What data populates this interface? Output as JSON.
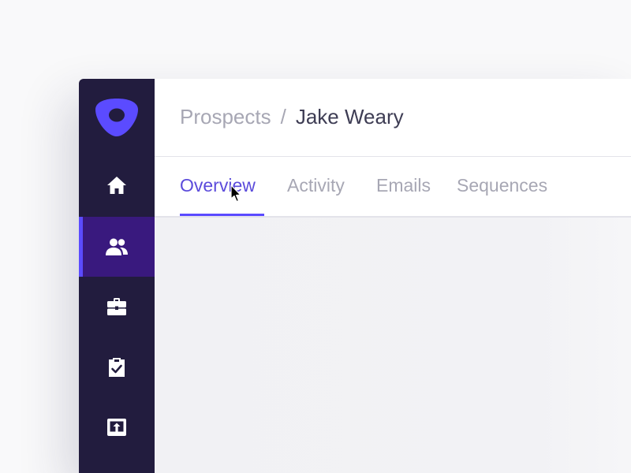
{
  "breadcrumb": {
    "parent": "Prospects",
    "separator": "/",
    "current": "Jake Weary"
  },
  "tabs": [
    {
      "label": "Overview",
      "active": true
    },
    {
      "label": "Activity",
      "active": false
    },
    {
      "label": "Emails",
      "active": false
    },
    {
      "label": "Sequences",
      "active": false
    }
  ],
  "sidebar": {
    "logo": "outreach-logo-icon",
    "items": [
      {
        "icon": "home-icon",
        "active": false
      },
      {
        "icon": "people-icon",
        "active": true
      },
      {
        "icon": "briefcase-icon",
        "active": false
      },
      {
        "icon": "clipboard-check-icon",
        "active": false
      },
      {
        "icon": "upload-icon",
        "active": false
      }
    ]
  },
  "colors": {
    "sidebar_bg": "#221c3e",
    "sidebar_active_bg": "#39197e",
    "accent": "#5b4bff",
    "tab_active_text": "#5b4bdb",
    "muted_text": "#a7a7b4",
    "title_text": "#3e3d54"
  }
}
